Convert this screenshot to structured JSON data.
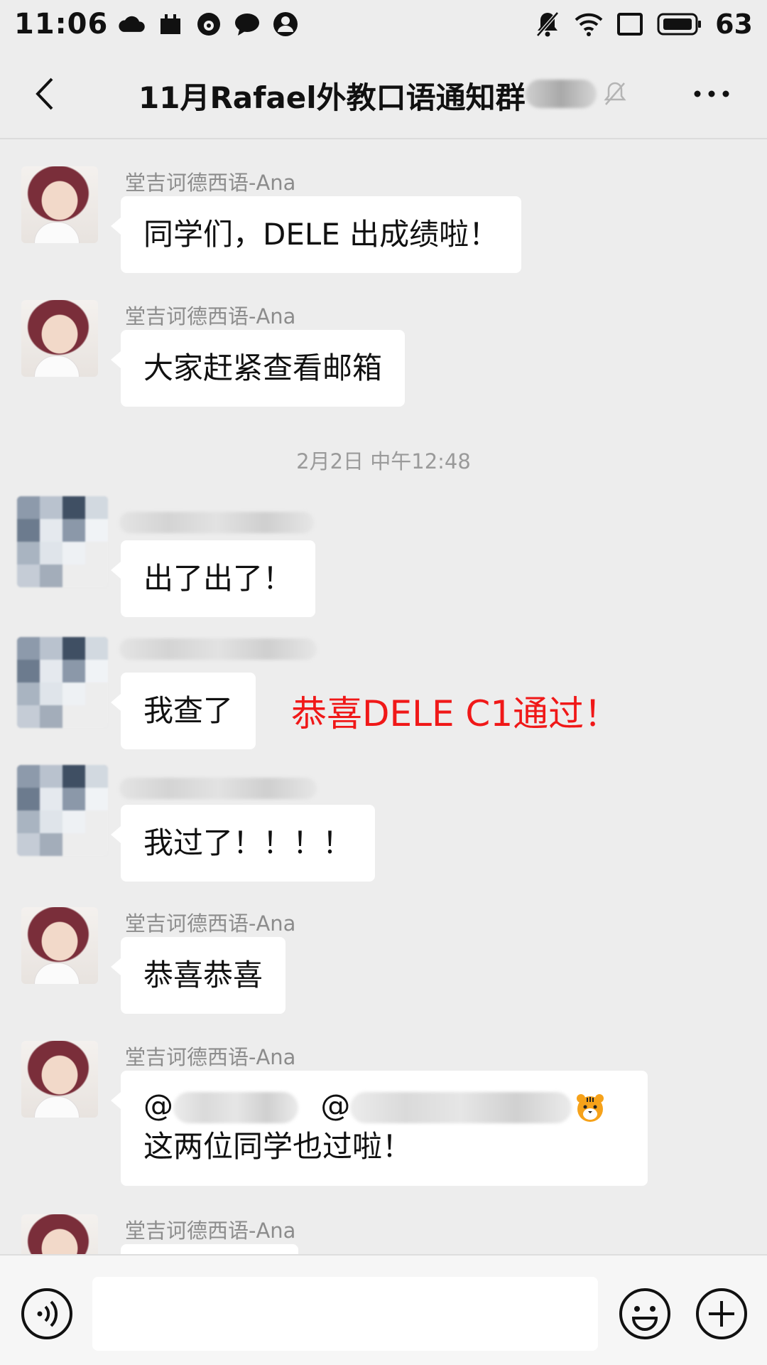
{
  "status_bar": {
    "time": "11:06",
    "battery": "63"
  },
  "header": {
    "title": "11月Rafael外教口语通知群"
  },
  "messages": [
    {
      "sender": "堂吉诃德西语-Ana",
      "text": "同学们，DELE 出成绩啦！"
    },
    {
      "sender": "堂吉诃德西语-Ana",
      "text": "大家赶紧查看邮箱"
    },
    {
      "text": "出了出了！"
    },
    {
      "text": "我查了"
    },
    {
      "text": "我过了！！！！"
    },
    {
      "sender": "堂吉诃德西语-Ana",
      "text": "恭喜恭喜"
    },
    {
      "sender": "堂吉诃德西语-Ana",
      "line1_at1": "@",
      "line1_at2": "@",
      "line2": "这两位同学也过啦！"
    },
    {
      "sender": "堂吉诃德西语-Ana"
    }
  ],
  "timestamp": "2月2日 中午12:48",
  "annotation": "恭喜DELE C1通过！",
  "colors": {
    "background": "#ededed",
    "bubble": "#ffffff",
    "annotation": "#f01818",
    "meta_text": "#8c8c8c"
  },
  "icons": [
    "back-arrow-icon",
    "mute-bell-icon",
    "more-icon",
    "voice-icon",
    "emoji-icon",
    "plus-icon"
  ]
}
